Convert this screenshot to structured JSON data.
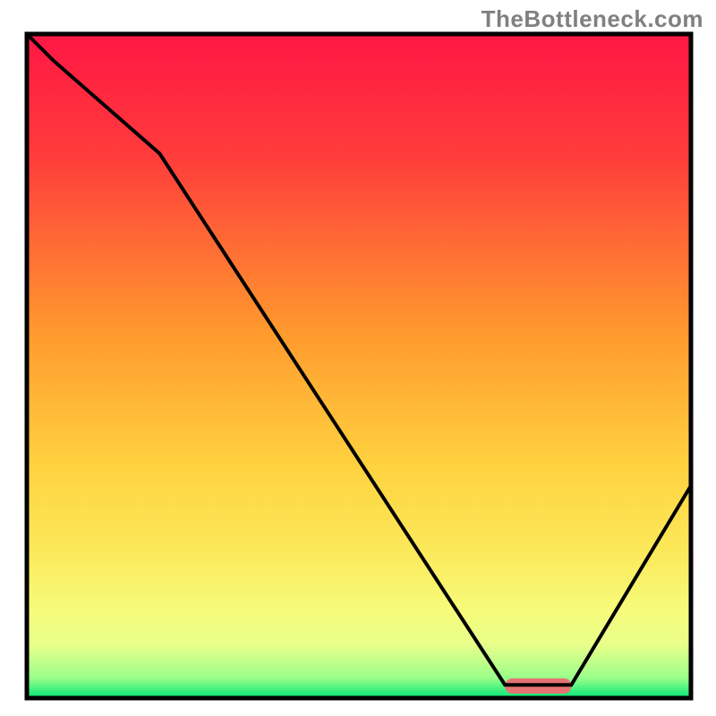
{
  "watermark": "TheBottleneck.com",
  "chart_data": {
    "type": "line",
    "title": "",
    "xlabel": "",
    "ylabel": "",
    "xlim": [
      0,
      100
    ],
    "ylim": [
      0,
      100
    ],
    "x": [
      0,
      4,
      20,
      72,
      82,
      100
    ],
    "values": [
      100,
      96,
      82,
      2,
      2,
      32
    ],
    "ideal_zone": {
      "start": 72,
      "end": 82
    },
    "gradient_stops": [
      {
        "offset": 0,
        "color": "#ff1744"
      },
      {
        "offset": 18,
        "color": "#ff3b3b"
      },
      {
        "offset": 45,
        "color": "#ff9a2e"
      },
      {
        "offset": 65,
        "color": "#ffd23f"
      },
      {
        "offset": 78,
        "color": "#fbe95a"
      },
      {
        "offset": 87,
        "color": "#f6fc7b"
      },
      {
        "offset": 92,
        "color": "#e8ff8a"
      },
      {
        "offset": 97,
        "color": "#9aff8a"
      },
      {
        "offset": 100,
        "color": "#00e676"
      }
    ]
  },
  "colors": {
    "bottleneck_bar": "#e57373",
    "curve": "#000000",
    "border": "#000000"
  }
}
